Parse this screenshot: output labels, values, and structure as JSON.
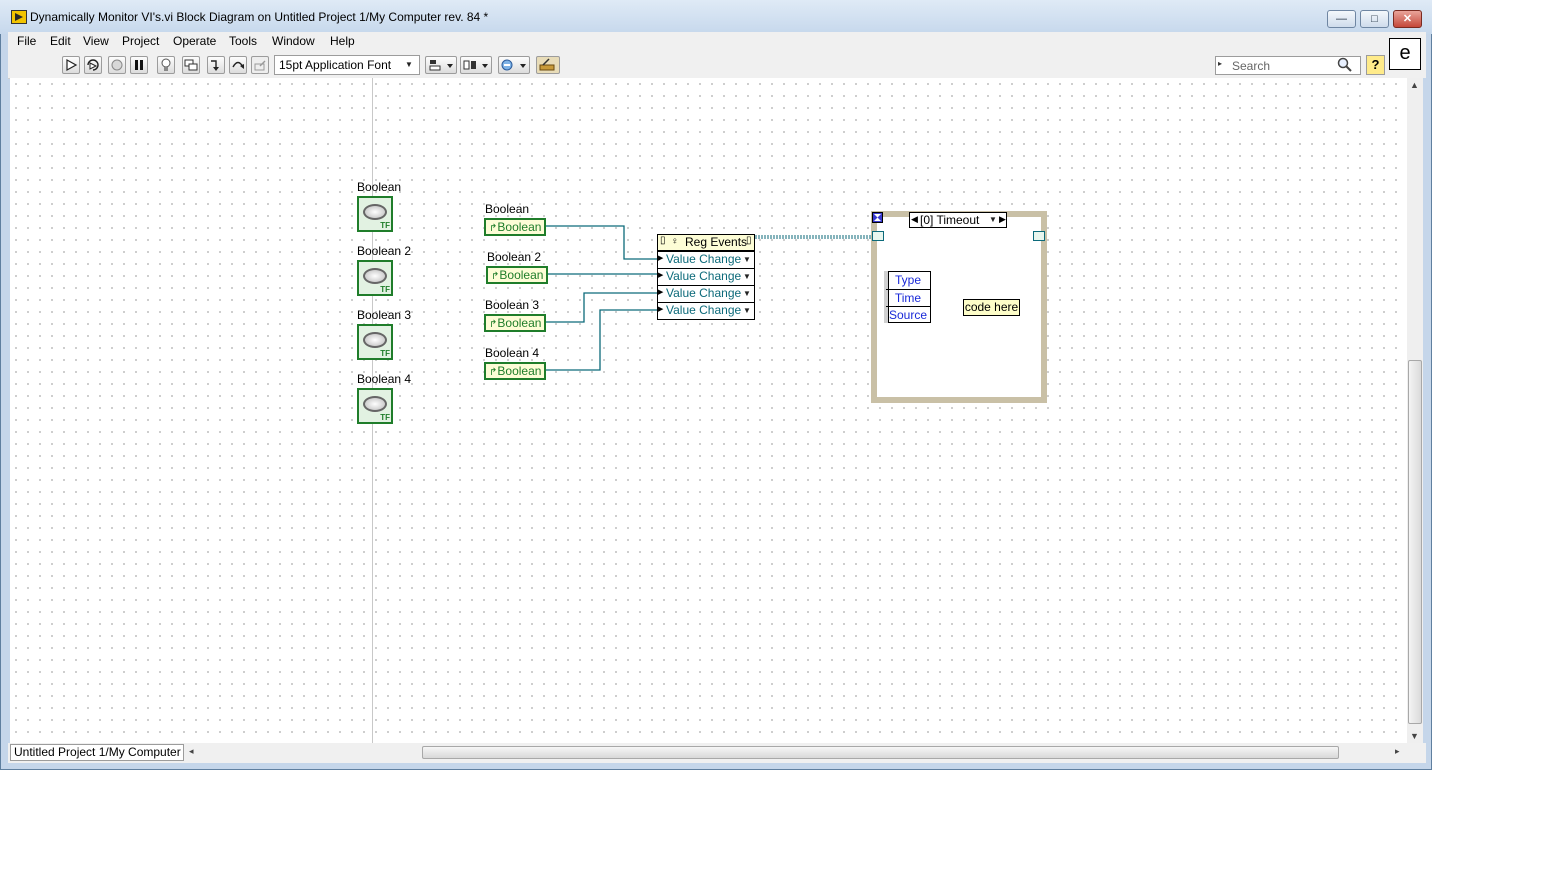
{
  "window": {
    "title": "Dynamically Monitor VI's.vi Block Diagram on Untitled Project 1/My Computer rev. 84 *",
    "minimize_glyph": "—",
    "maximize_glyph": "□",
    "close_glyph": "✕"
  },
  "menu": [
    "File",
    "Edit",
    "View",
    "Project",
    "Operate",
    "Tools",
    "Window",
    "Help"
  ],
  "toolbar": {
    "font": "15pt Application Font",
    "search_placeholder": "Search",
    "help_label": "?",
    "context_icon": "e"
  },
  "diagram": {
    "terminals": [
      "Boolean",
      "Boolean 2",
      "Boolean 3",
      "Boolean 4"
    ],
    "terminal_tf": "TF",
    "references": [
      {
        "label": "Boolean",
        "value": "Boolean"
      },
      {
        "label": "Boolean 2",
        "value": "Boolean"
      },
      {
        "label": "Boolean 3",
        "value": "Boolean"
      },
      {
        "label": "Boolean 4",
        "value": "Boolean"
      }
    ],
    "reg_events": {
      "title": "Reg Events",
      "rows": [
        "Value Change",
        "Value Change",
        "Value Change",
        "Value Change"
      ]
    },
    "event_structure": {
      "selector": "[0] Timeout",
      "event_data": [
        "Type",
        "Time",
        "Source"
      ],
      "comment": "code here"
    }
  },
  "status": {
    "context": "Untitled Project 1/My Computer"
  },
  "colors": {
    "boolean_wire": "#1f7d2a",
    "refnum_wire": "#0c6a7a",
    "event_data_text": "#1a2ad8"
  }
}
